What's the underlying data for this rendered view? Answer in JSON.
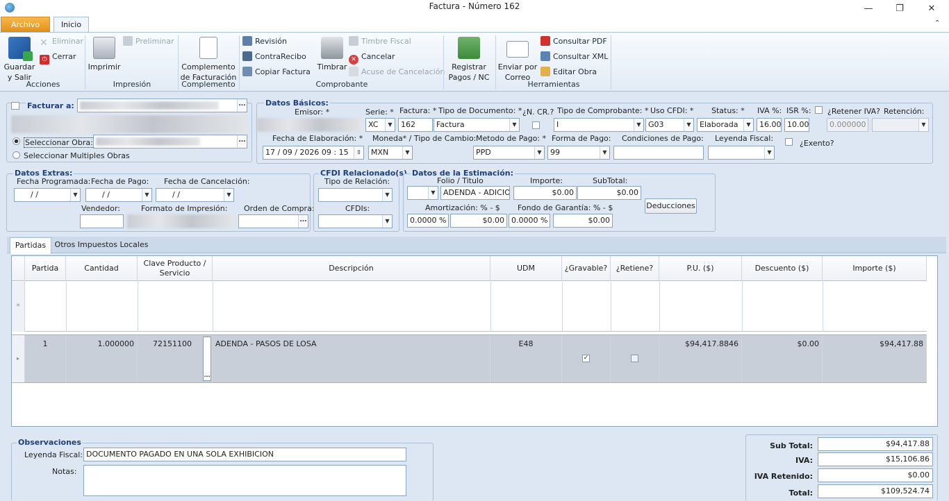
{
  "window": {
    "title": "Factura - Número 162",
    "minimize": "—",
    "restore": "❐",
    "close": "✕"
  },
  "ribbon_tabs": {
    "archivo": "Archivo",
    "inicio": "Inicio"
  },
  "ribbon": {
    "acciones": {
      "guardar": "Guardar\ny Salir",
      "eliminar": "Eliminar",
      "cerrar": "Cerrar",
      "group": "Acciones"
    },
    "impresion": {
      "imprimir": "Imprimir",
      "preliminar": "Preliminar",
      "group": "Impresión"
    },
    "complemento": {
      "btn": "Complemento\nde Facturación",
      "group": "Complemento"
    },
    "comprobante": {
      "revision": "Revisión",
      "contrarecibo": "ContraRecibo",
      "copiar": "Copiar Factura",
      "timbrar": "Timbrar",
      "timbre_fiscal": "Timbre Fiscal",
      "cancelar": "Cancelar",
      "acuse": "Acuse de Cancelación",
      "group": "Comprobante"
    },
    "pagos": {
      "btn": "Registrar\nPagos / NC"
    },
    "herramientas": {
      "enviar": "Enviar por\nCorreo",
      "pdf": "Consultar PDF",
      "xml": "Consultar XML",
      "editar": "Editar Obra",
      "group": "Herramientas"
    }
  },
  "facturar": {
    "legend": "Facturar a: *",
    "seleccionar_obra": "Seleccionar Obra:",
    "multiples": "Seleccionar Multiples Obras"
  },
  "basicos": {
    "legend": "Datos Básicos:",
    "emisor_lbl": "Emisor: *",
    "serie_lbl": "Serie: *",
    "serie": "XC",
    "factura_lbl": "Factura: *",
    "factura": "162",
    "tipo_doc_lbl": "Tipo de Documento: *",
    "tipo_doc": "Factura",
    "ncr_lbl": "¿N. CR.?",
    "tipo_comp_lbl": "Tipo de Comprobante: *",
    "tipo_comp": "I",
    "uso_lbl": "Uso CFDI: *",
    "uso": "G03",
    "status_lbl": "Status: *",
    "status": "Elaborada",
    "iva_lbl": "IVA %:",
    "iva": "16.00",
    "isr_lbl": "ISR %:",
    "isr": "10.00",
    "retener_lbl": "¿Retener IVA?",
    "retener": "0.000000",
    "retencion_lbl": "Retención:",
    "fecha_lbl": "Fecha de Elaboración: *",
    "fecha": "17 / 09 / 2026   09 : 15",
    "moneda_lbl": "Moneda* / Tipo de Cambio:",
    "moneda": "MXN",
    "metodo_lbl": "Metodo de Pago: *",
    "metodo": "PPD",
    "forma_lbl": "Forma de Pago:",
    "forma": "99",
    "condiciones_lbl": "Condiciones de Pago:",
    "leyenda_lbl": "Leyenda Fiscal:",
    "exento_lbl": "¿Exento?"
  },
  "extras": {
    "legend": "Datos Extras:",
    "fecha_prog": "Fecha Programada:",
    "fecha_pago": "Fecha de Pago:",
    "fecha_canc": "Fecha de Cancelación:",
    "empty_date": "/     /",
    "vendedor": "Vendedor:",
    "formato": "Formato de Impresión:",
    "orden": "Orden de Compra:"
  },
  "cfdi": {
    "legend": "CFDI Relacionado(s)",
    "tipo_rel": "Tipo de Relación:",
    "cfdis": "CFDIs:"
  },
  "estimacion": {
    "legend": "Datos de la Estimación:",
    "folio_lbl": "Folio / Titulo",
    "folio": "ADENDA - ADICION",
    "importe_lbl": "Importe:",
    "importe": "$0.00",
    "subtotal_lbl": "SubTotal:",
    "subtotal": "$0.00",
    "amort_lbl": "Amortización: % - $",
    "amort_pct": "0.0000 %",
    "amort_val": "$0.00",
    "fondo_lbl": "Fondo de Garantía: % - $",
    "fondo_pct": "0.0000 %",
    "fondo_val": "$0.00",
    "deducciones": "Deducciones"
  },
  "tabs": {
    "partidas": "Partidas",
    "otros": "Otros Impuestos Locales"
  },
  "grid": {
    "headers": [
      "Partida",
      "Cantidad",
      "Clave Producto /\nServicio",
      "Descripción",
      "UDM",
      "¿Gravable?",
      "¿Retiene?",
      "P.U. ($)",
      "Descuento ($)",
      "Importe ($)"
    ],
    "new_row_marker": "*",
    "rows": [
      {
        "partida": "1",
        "cantidad": "1.000000",
        "clave": "72151100",
        "descripcion": "ADENDA - PASOS DE LOSA",
        "udm": "E48",
        "gravable": true,
        "retiene": false,
        "pu": "$94,417.8846",
        "descuento": "$0.00",
        "importe": "$94,417.88"
      }
    ]
  },
  "observaciones": {
    "legend": "Observaciones",
    "leyenda_lbl": "Leyenda Fiscal:",
    "leyenda": "DOCUMENTO PAGADO EN UNA SOLA EXHIBICION",
    "notas_lbl": "Notas:"
  },
  "totales": {
    "subtotal_lbl": "Sub Total:",
    "subtotal": "$94,417.88",
    "iva_lbl": "IVA:",
    "iva": "$15,106.86",
    "ivaret_lbl": "IVA Retenido:",
    "ivaret": "$0.00",
    "total_lbl": "Total:",
    "total": "$109,524.74"
  }
}
